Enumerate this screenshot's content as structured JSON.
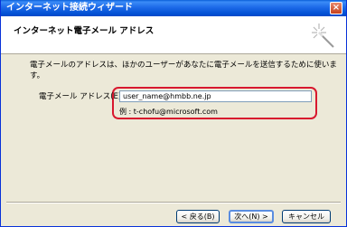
{
  "window": {
    "title": "インターネット接続ウィザード",
    "close_symbol": "×"
  },
  "header": {
    "title": "インターネット電子メール アドレス",
    "icon": "wizard-sparkle-icon"
  },
  "body": {
    "description": "電子メールのアドレスは、ほかのユーザーがあなたに電子メールを送信するために使います。",
    "email_label": "電子メール アドレス(E):",
    "email_value": "user_name@hmbb.ne.jp",
    "example": "例 : t-chofu@microsoft.com"
  },
  "buttons": {
    "back": "< 戻る(B)",
    "next": "次へ(N) >",
    "cancel": "キャンセル"
  },
  "colors": {
    "titlebar": "#0a5fd8",
    "dialog_bg": "#ece9d8",
    "highlight": "#d8182e"
  }
}
